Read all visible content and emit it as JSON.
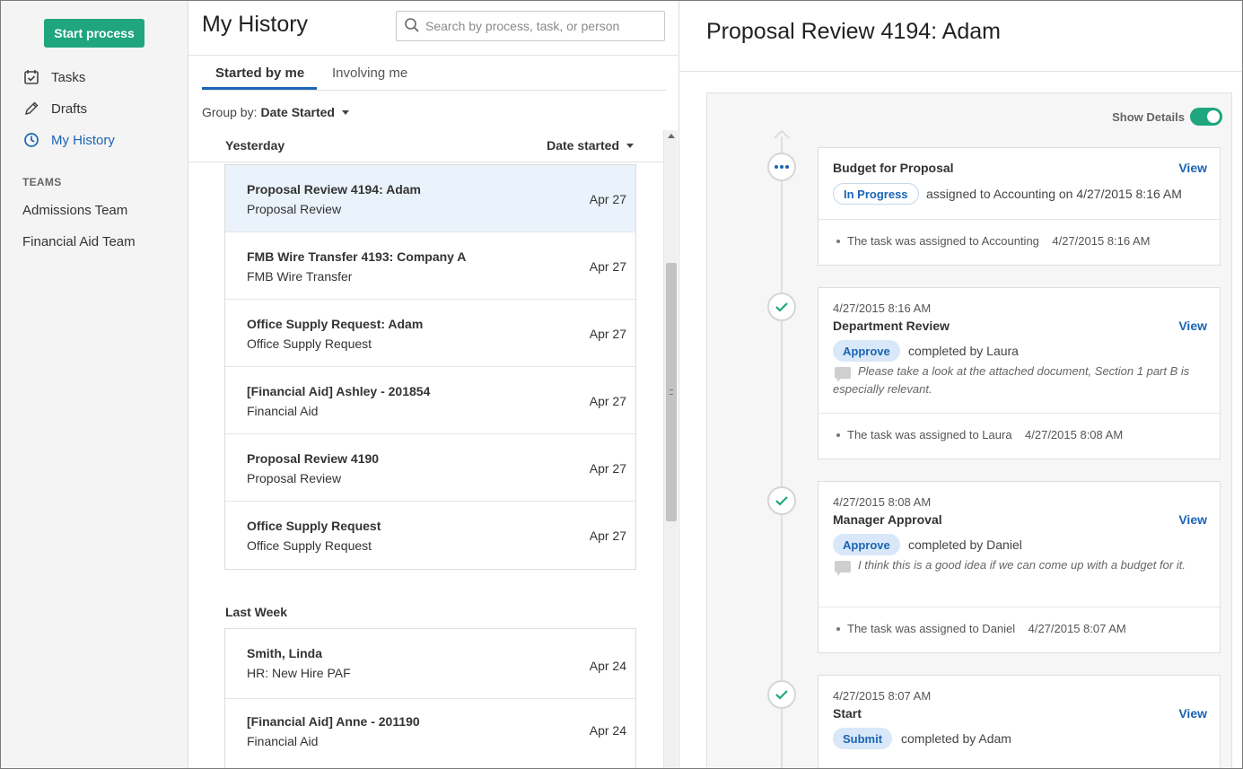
{
  "nav": {
    "start_label": "Start process",
    "items": [
      {
        "label": "Tasks",
        "icon": "calendar-check-icon"
      },
      {
        "label": "Drafts",
        "icon": "pencil-icon"
      },
      {
        "label": "My History",
        "icon": "clock-icon"
      }
    ],
    "teams_label": "TEAMS",
    "teams": [
      "Admissions Team",
      "Financial Aid Team"
    ]
  },
  "history": {
    "title": "My History",
    "search_placeholder": "Search by process, task, or person",
    "tabs": [
      {
        "label": "Started by me",
        "active": true
      },
      {
        "label": "Involving me",
        "active": false
      }
    ],
    "group_by_label": "Group by:",
    "group_by_value": "Date Started",
    "sort_label": "Date started",
    "groups": [
      {
        "label": "Yesterday",
        "rows": [
          {
            "title": "Proposal Review 4194: Adam",
            "process": "Proposal Review",
            "date": "Apr 27",
            "selected": true
          },
          {
            "title": "FMB Wire Transfer 4193: Company A",
            "process": "FMB Wire Transfer",
            "date": "Apr 27"
          },
          {
            "title": "Office Supply Request: Adam",
            "process": "Office Supply Request",
            "date": "Apr 27"
          },
          {
            "title": "[Financial Aid] Ashley - 201854",
            "process": "Financial Aid",
            "date": "Apr 27"
          },
          {
            "title": "Proposal Review 4190",
            "process": "Proposal Review",
            "date": "Apr 27"
          },
          {
            "title": "Office Supply Request",
            "process": "Office Supply Request",
            "date": "Apr 27"
          }
        ]
      },
      {
        "label": "Last Week",
        "rows": [
          {
            "title": "Smith, Linda",
            "process": "HR: New Hire PAF",
            "date": "Apr 24"
          },
          {
            "title": "[Financial Aid] Anne  - 201190",
            "process": "Financial Aid",
            "date": "Apr 24"
          }
        ]
      }
    ]
  },
  "detail": {
    "title": "Proposal Review 4194: Adam",
    "show_details_label": "Show Details",
    "show_details_on": true,
    "view_label": "View",
    "events": [
      {
        "status": "in-progress",
        "node_icon": "ellipsis-icon",
        "name": "Budget for Proposal",
        "pill": "In Progress",
        "desc": "assigned to Accounting on 4/27/2015 8:16 AM",
        "sub": "The task was assigned to Accounting",
        "sub_time": "4/27/2015 8:16 AM"
      },
      {
        "status": "done",
        "node_icon": "check-icon",
        "timestamp": "4/27/2015 8:16 AM",
        "name": "Department Review",
        "pill": "Approve",
        "desc": "completed by Laura",
        "comment": "Please take a look at the attached document, Section 1 part B is especially relevant.",
        "sub": "The task was assigned to Laura",
        "sub_time": "4/27/2015 8:08 AM"
      },
      {
        "status": "done",
        "node_icon": "check-icon",
        "timestamp": "4/27/2015 8:08 AM",
        "name": "Manager Approval",
        "pill": "Approve",
        "desc": "completed by Daniel",
        "comment": "I think this is a good idea if we can come up with a budget for it.",
        "sub": "The task was assigned to Daniel",
        "sub_time": "4/27/2015 8:07 AM"
      },
      {
        "status": "done",
        "node_icon": "check-icon",
        "timestamp": "4/27/2015 8:07 AM",
        "name": "Start",
        "pill": "Submit",
        "desc": "completed by Adam"
      }
    ]
  },
  "colors": {
    "accent_green": "#1fa67e",
    "link_blue": "#1b64b5",
    "selected_row": "#eaf2fb"
  }
}
